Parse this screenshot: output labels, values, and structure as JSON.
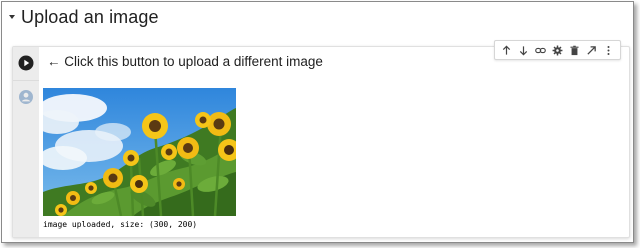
{
  "section": {
    "title": "Upload an image"
  },
  "cell": {
    "code_text": "← Click this button to upload a different image",
    "output_text": "image uploaded, size: (300, 200)"
  },
  "toolbar": {
    "icons": [
      "arrow-up-icon",
      "arrow-down-icon",
      "link-icon",
      "gear-icon",
      "trash-icon",
      "open-in-new-icon",
      "more-vert-icon"
    ]
  },
  "colors": {
    "sky": "#4a9be0",
    "petal": "#f5c518",
    "leaf": "#4f8a2a",
    "gutter": "#ececec"
  }
}
